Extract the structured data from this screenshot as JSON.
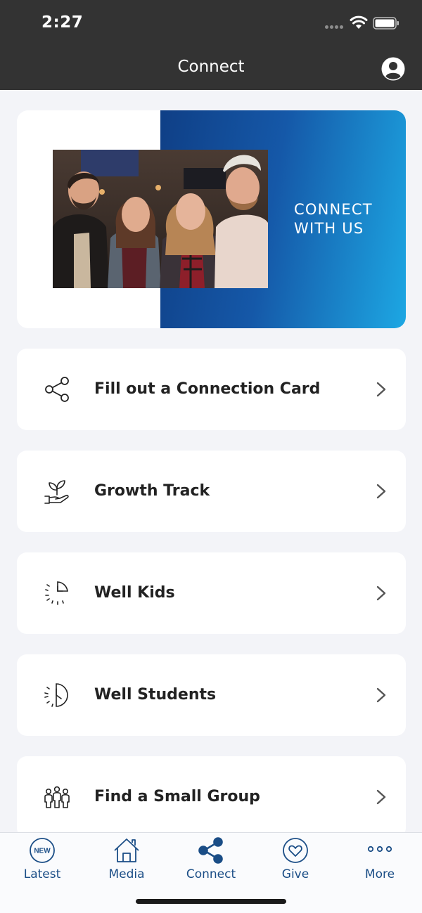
{
  "status_bar": {
    "time": "2:27"
  },
  "nav": {
    "title": "Connect"
  },
  "hero": {
    "line1": "CONNECT",
    "line2": "WITH US"
  },
  "menu": [
    {
      "label": "Fill out a Connection Card",
      "icon": "share-icon"
    },
    {
      "label": "Growth Track",
      "icon": "plant-hand-icon"
    },
    {
      "label": "Well Kids",
      "icon": "partial-clock-icon"
    },
    {
      "label": "Well Students",
      "icon": "half-clock-icon"
    },
    {
      "label": "Find a Small Group",
      "icon": "group-people-icon"
    }
  ],
  "tabs": [
    {
      "label": "Latest",
      "icon": "new-badge-icon",
      "badge": "NEW"
    },
    {
      "label": "Media",
      "icon": "home-icon"
    },
    {
      "label": "Connect",
      "icon": "share-icon"
    },
    {
      "label": "Give",
      "icon": "heart-icon"
    },
    {
      "label": "More",
      "icon": "more-dots-icon"
    }
  ],
  "colors": {
    "header": "#333333",
    "accent": "#1a4d86",
    "gradient_start": "#0f3f86",
    "gradient_end": "#1da7e3"
  }
}
